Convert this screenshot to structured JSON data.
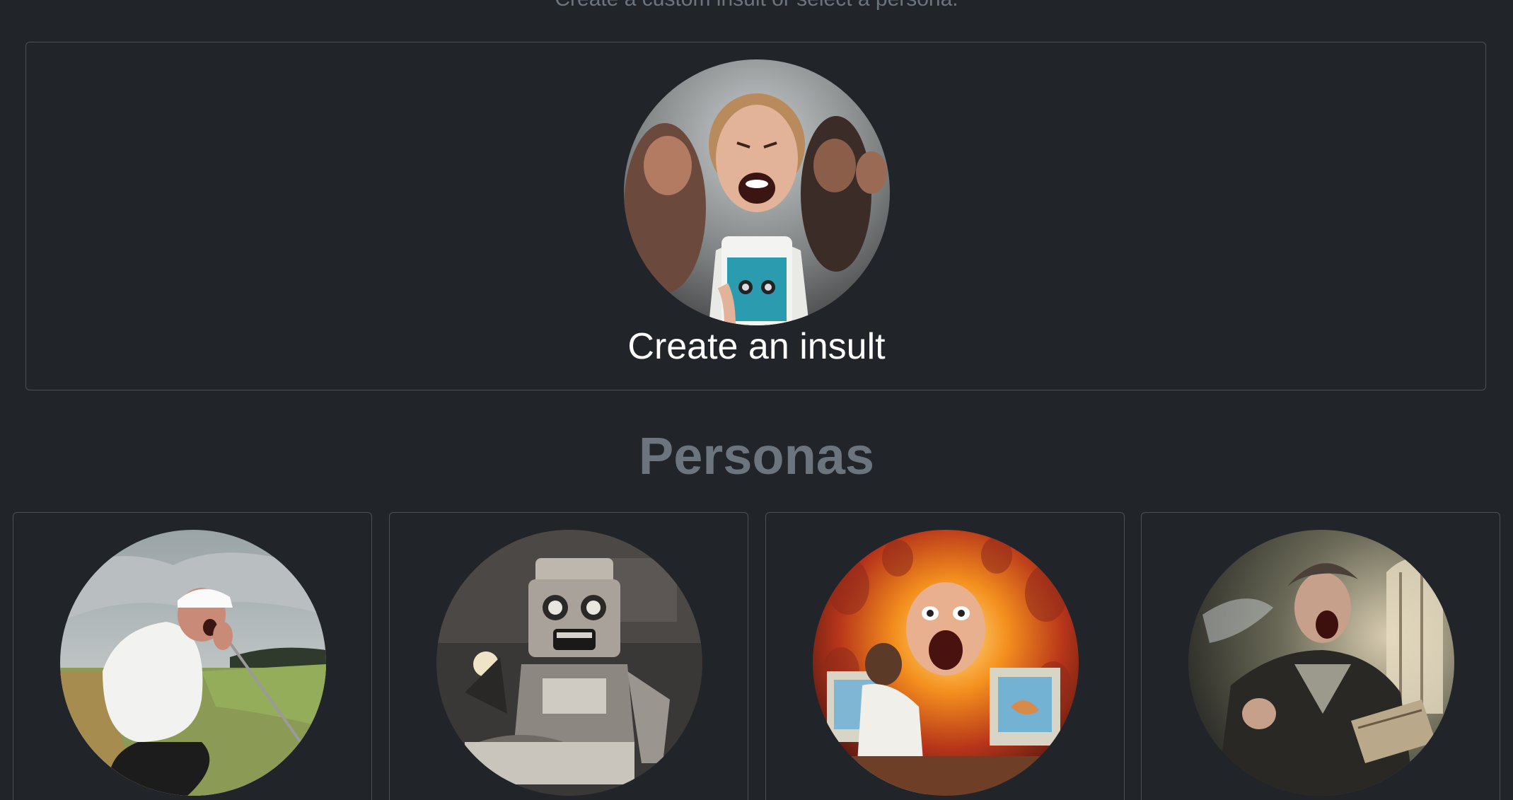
{
  "header": {
    "subtitle": "Create a custom insult or select a persona."
  },
  "create_card": {
    "label": "Create an insult",
    "image_icon": "screaming-woman-with-phone-illustration"
  },
  "personas_section": {
    "title": "Personas",
    "cards": [
      {
        "image_icon": "screaming-golfer-illustration"
      },
      {
        "image_icon": "screaming-robot-at-keyboard-illustration"
      },
      {
        "image_icon": "screaming-face-in-monitor-illustration"
      },
      {
        "image_icon": "screaming-man-with-book-illustration"
      }
    ]
  }
}
